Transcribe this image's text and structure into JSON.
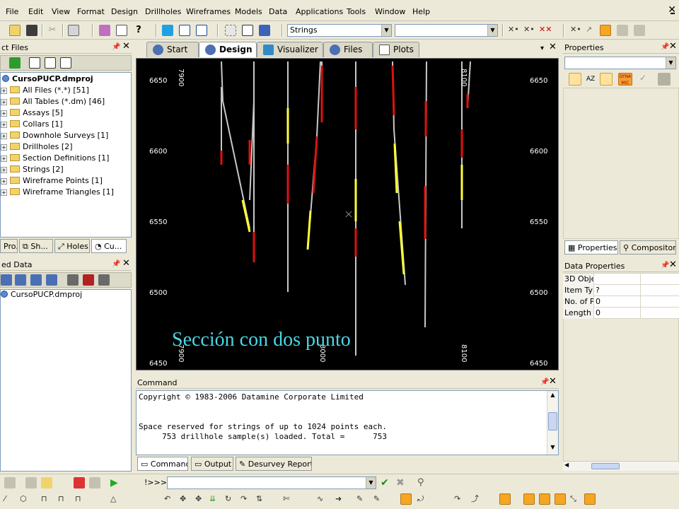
{
  "menu": [
    "File",
    "Edit",
    "View",
    "Format",
    "Design",
    "Drillholes",
    "Wireframes",
    "Models",
    "Data",
    "Applications",
    "Tools",
    "Window",
    "Help"
  ],
  "toolbar": {
    "strings_combo": "Strings",
    "second_combo": ""
  },
  "project_files": {
    "title": "ct Files",
    "root": "CursoPUCP.dmproj",
    "items": [
      "All Files (*.*) [51]",
      "All Tables (*.dm) [46]",
      "Assays [5]",
      "Collars [1]",
      "Downhole Surveys [1]",
      "Drillholes [2]",
      "Section Definitions [1]",
      "Strings [2]",
      "Wireframe Points [1]",
      "Wireframe Triangles [1]"
    ],
    "tabs": [
      "Pro...",
      "Sh...",
      "Holes",
      "Cu..."
    ]
  },
  "loaded_data": {
    "title": "ed Data",
    "root": "CursoPUCP.dmproj"
  },
  "doc_tabs": [
    "Start",
    "Design",
    "Visualizer",
    "Files",
    "Plots"
  ],
  "viewport": {
    "y_labels": [
      "6650",
      "6600",
      "6550",
      "6500",
      "6450"
    ],
    "x_labels_top": [
      "7900",
      "8100"
    ],
    "x_labels_bottom": [
      "7900",
      "8000",
      "8100"
    ],
    "annotation": "Sección con dos punto"
  },
  "command": {
    "title": "Command",
    "lines": [
      "Copyright © 1983-2006 Datamine Corporate Limited",
      "",
      "",
      "Space reserved for strings of up to 1024 points each.",
      "     753 drillhole sample(s) loaded. Total =      753"
    ],
    "tabs": [
      "Command",
      "Output",
      "Desurvey Report"
    ],
    "prompt": "!>>>"
  },
  "properties": {
    "title": "Properties",
    "tabs": [
      "Properties",
      "Compositor"
    ]
  },
  "data_properties": {
    "title": "Data Properties",
    "rows": [
      {
        "key": "3D Obje",
        "value": ""
      },
      {
        "key": "Item Ty",
        "value": "?"
      },
      {
        "key": "No. of P",
        "value": "0"
      },
      {
        "key": "Length",
        "value": "0"
      }
    ]
  },
  "colors": {
    "accent": "#f2d36b",
    "trace_grey": "#c8c8c8",
    "trace_yellow": "#ffff33",
    "trace_red": "#e01010",
    "annotation": "#4ad7e6"
  }
}
